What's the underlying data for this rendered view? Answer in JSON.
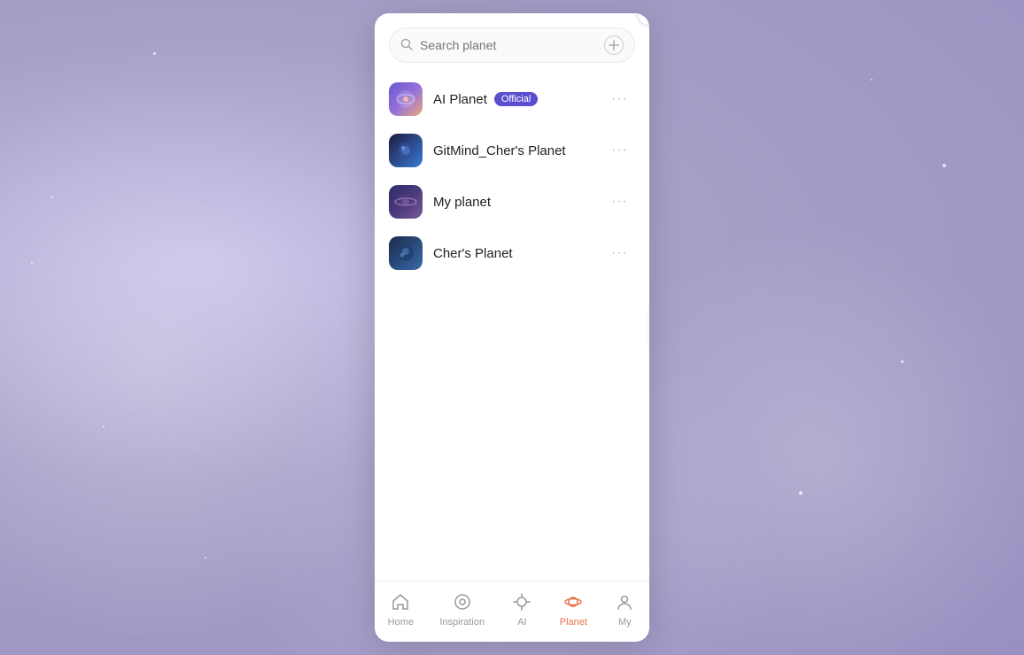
{
  "background": {
    "color": "#b0a8d0"
  },
  "modal": {
    "close_label": "×",
    "search": {
      "placeholder": "Search planet"
    },
    "add_button_label": "+",
    "planets": [
      {
        "id": "ai-planet",
        "name": "AI Planet",
        "badge": "Official",
        "avatar_type": "ai",
        "avatar_emoji": "🌐"
      },
      {
        "id": "gitmind",
        "name": "GitMind_Cher's Planet",
        "badge": null,
        "avatar_type": "gitmind",
        "avatar_emoji": "🌍"
      },
      {
        "id": "my-planet",
        "name": "My planet",
        "badge": null,
        "avatar_type": "my-planet",
        "avatar_emoji": "🪐"
      },
      {
        "id": "chers-planet",
        "name": "Cher's Planet",
        "badge": null,
        "avatar_type": "chers",
        "avatar_emoji": "🌏"
      }
    ],
    "more_btn_label": "···"
  },
  "bottom_nav": {
    "items": [
      {
        "id": "home",
        "label": "Home",
        "icon": "⌂",
        "active": false
      },
      {
        "id": "inspiration",
        "label": "Inspiration",
        "icon": "◯",
        "active": false
      },
      {
        "id": "ai",
        "label": "AI",
        "icon": "◎",
        "active": false
      },
      {
        "id": "planet",
        "label": "Planet",
        "icon": "🪐",
        "active": true
      },
      {
        "id": "my",
        "label": "My",
        "icon": "👤",
        "active": false
      }
    ]
  }
}
